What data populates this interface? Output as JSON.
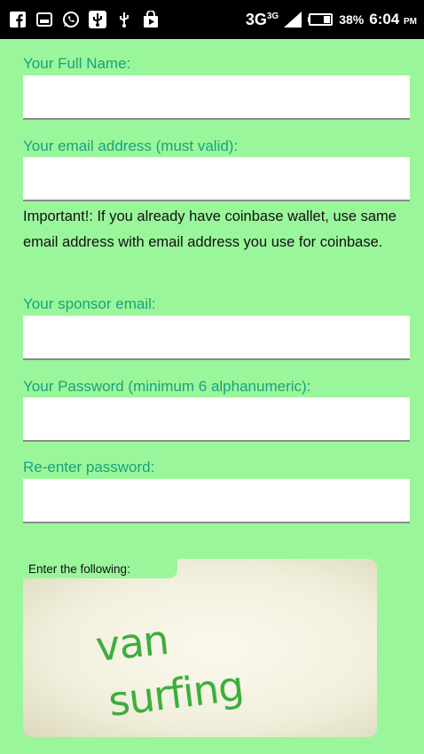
{
  "statusbar": {
    "icons": [
      "facebook-icon",
      "gallery-icon",
      "whatsapp-icon",
      "usb-icon",
      "usb-icon",
      "play-store-icon"
    ],
    "network": "3G",
    "network_sup": "3G",
    "battery_percent": "38%",
    "time": "6:04",
    "ampm": "PM"
  },
  "form": {
    "full_name_label": "Your Full Name:",
    "email_label": "Your email address (must valid):",
    "important_note": "Important!: If you already have coinbase wallet, use same email address with email address you use for coinbase.",
    "sponsor_label": "Your sponsor email:",
    "password_label": "Your Password (minimum 6 alphanumeric):",
    "reenter_label": "Re-enter password:",
    "full_name_value": "",
    "email_value": "",
    "sponsor_value": "",
    "password_value": "",
    "reenter_value": ""
  },
  "captcha": {
    "title": "Enter the following:",
    "word1": "van",
    "word2": "surfing"
  },
  "colors": {
    "background": "#9AF69A",
    "label": "#19A27C",
    "captcha_text": "#3DAE3D"
  }
}
